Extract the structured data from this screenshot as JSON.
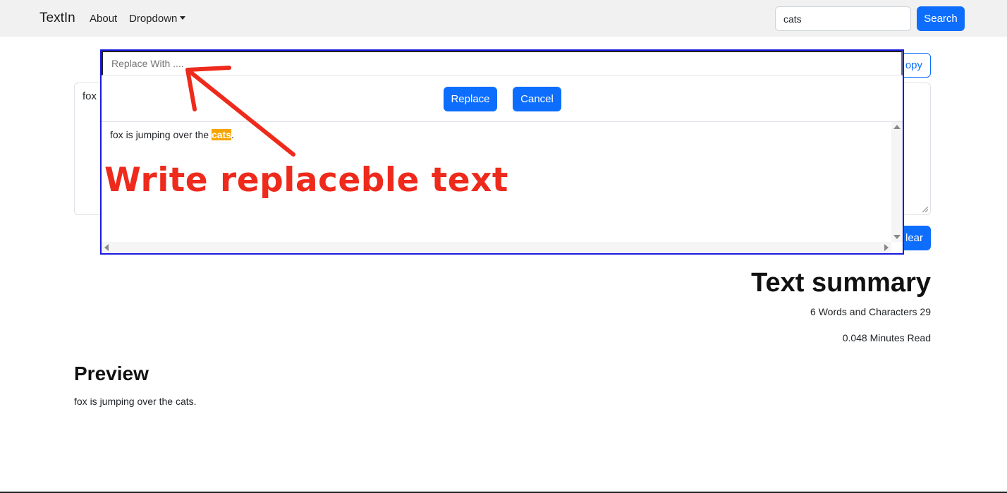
{
  "navbar": {
    "brand": "TextIn",
    "links": [
      "About",
      "Dropdown"
    ],
    "search_value": "cats",
    "search_button": "Search"
  },
  "page": {
    "copy_label": "opy",
    "textarea_value": "fox",
    "clear_label": "lear",
    "summary_title": "Text summary",
    "summary_counts": "6 Words and Characters 29",
    "summary_read": "0.048 Minutes Read",
    "preview_title": "Preview",
    "preview_text": "fox is jumping over the cats."
  },
  "replace_panel": {
    "placeholder": "Replace With ....",
    "replace_button": "Replace",
    "cancel_button": "Cancel",
    "text_before": "fox is jumping over the ",
    "text_match": "cats",
    "text_after": "."
  },
  "annotation": {
    "text": "Write replaceble text",
    "color": "#ee2a1c"
  },
  "colors": {
    "primary": "#0d6efd",
    "highlight": "#f5a400",
    "panel_border": "#1a1ae0",
    "navbar_bg": "#f1f1f1"
  }
}
